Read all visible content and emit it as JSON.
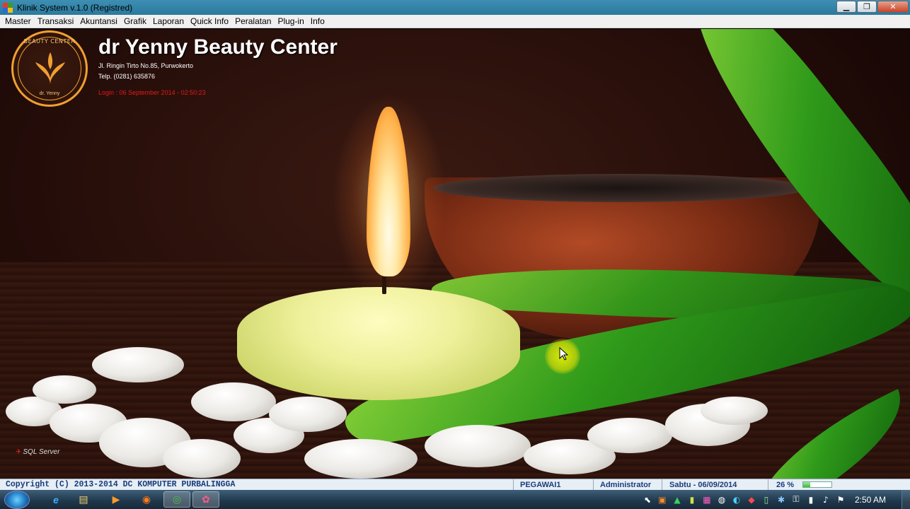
{
  "window": {
    "title": "Klinik System v.1.0 (Registred)",
    "controls": {
      "minimize": "▁",
      "maximize": "❐",
      "close": "✕"
    }
  },
  "menu": [
    "Master",
    "Transaksi",
    "Akuntansi",
    "Grafik",
    "Laporan",
    "Quick Info",
    "Peralatan",
    "Plug-in",
    "Info"
  ],
  "header": {
    "logo": {
      "top_text": "BEAUTY CENTER",
      "bottom_text": "dr. Yenny"
    },
    "brand_title": "dr Yenny Beauty Center",
    "address": "Jl. Ringin Tirto No.85, Purwokerto",
    "phone": "Telp. (0281) 635876",
    "login": "Login : 06 September 2014 - 02:50:23"
  },
  "sql_badge": "SQL Server",
  "statusbar": {
    "copyright": "Copyright (C) 2013-2014 DC KOMPUTER PURBALINGGA",
    "user_role": "PEGAWAI1",
    "user_name": "Administrator",
    "date": "Sabtu - 06/09/2014",
    "progress_label": "26 %",
    "progress_value": 0.26
  },
  "taskbar": {
    "apps": [
      "ie-icon",
      "explorer-icon",
      "media-player-icon",
      "firefox-icon",
      "chrome-icon",
      "klinik-app-icon"
    ],
    "app_glyphs": [
      "e",
      "▤",
      "▶",
      "◉",
      "◎",
      "✿"
    ],
    "tray_glyphs": [
      "⬉",
      "▣",
      "▲",
      "▮",
      "▦",
      "◍",
      "◐",
      "◆",
      "▯",
      "✱",
      "⚿",
      "▮",
      "♪",
      "⚑"
    ],
    "clock": "2:50 AM"
  },
  "colors": {
    "accent_blue": "#1a3c78",
    "login_red": "#e41a1a",
    "logo_gold": "#f0a030"
  }
}
